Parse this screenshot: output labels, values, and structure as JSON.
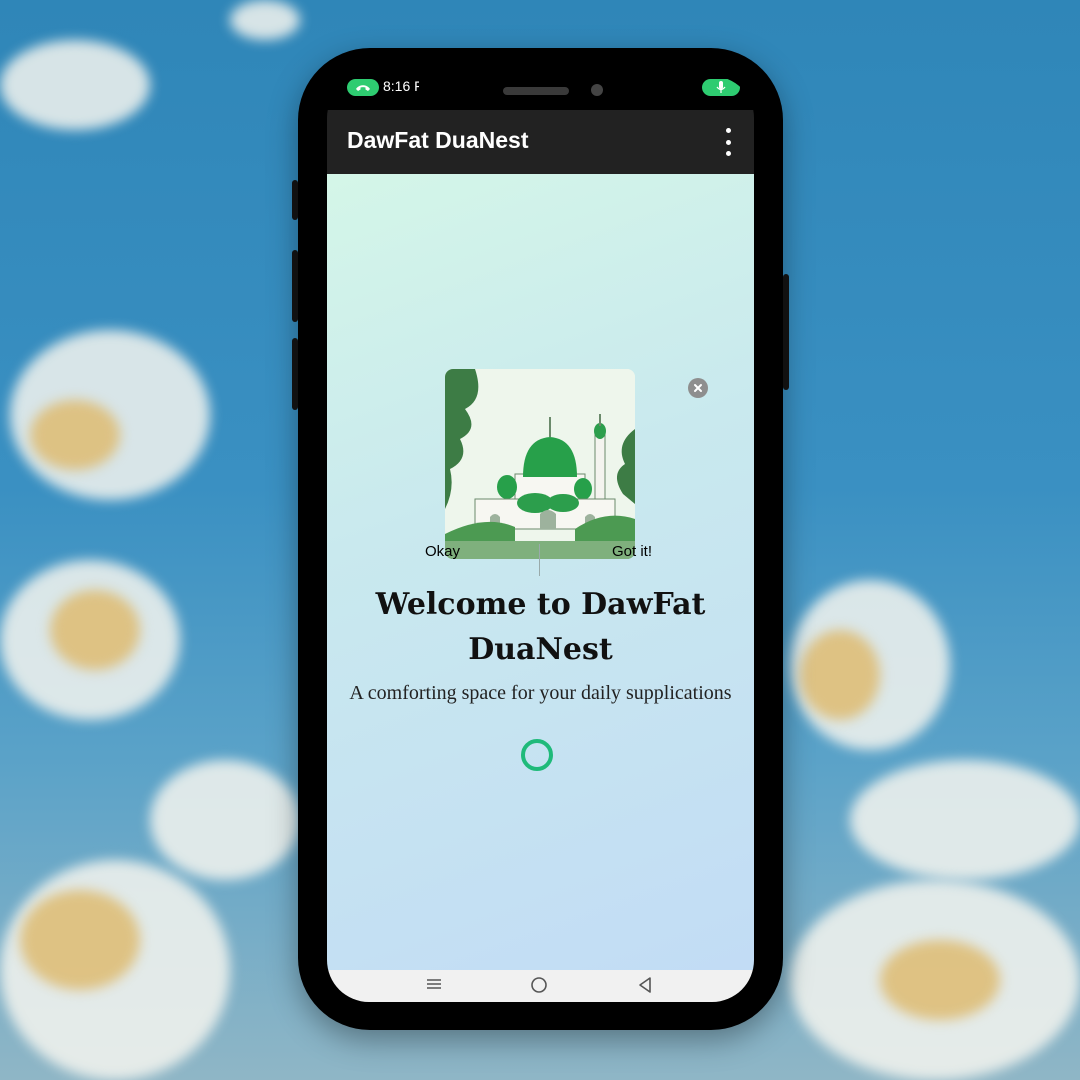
{
  "status_bar": {
    "time": "8:16 F",
    "call_icon": "phone-icon",
    "mic_icon": "mic-icon"
  },
  "app_bar": {
    "title": "DawFat DuaNest",
    "menu_icon": "more-vert-icon"
  },
  "ad": {
    "close_icon": "close-icon",
    "left_button": "Okay",
    "right_button": "Got it!"
  },
  "welcome": {
    "title": "Welcome to DawFat DuaNest",
    "subtitle": "A comforting space for your daily supplications"
  },
  "nav_bar": {
    "recents_icon": "menu-lines-icon",
    "home_icon": "home-circle-icon",
    "back_icon": "back-triangle-icon"
  },
  "colors": {
    "accent": "#1fba7a",
    "app_bar": "#222222",
    "status_pill": "#2ecc71"
  }
}
